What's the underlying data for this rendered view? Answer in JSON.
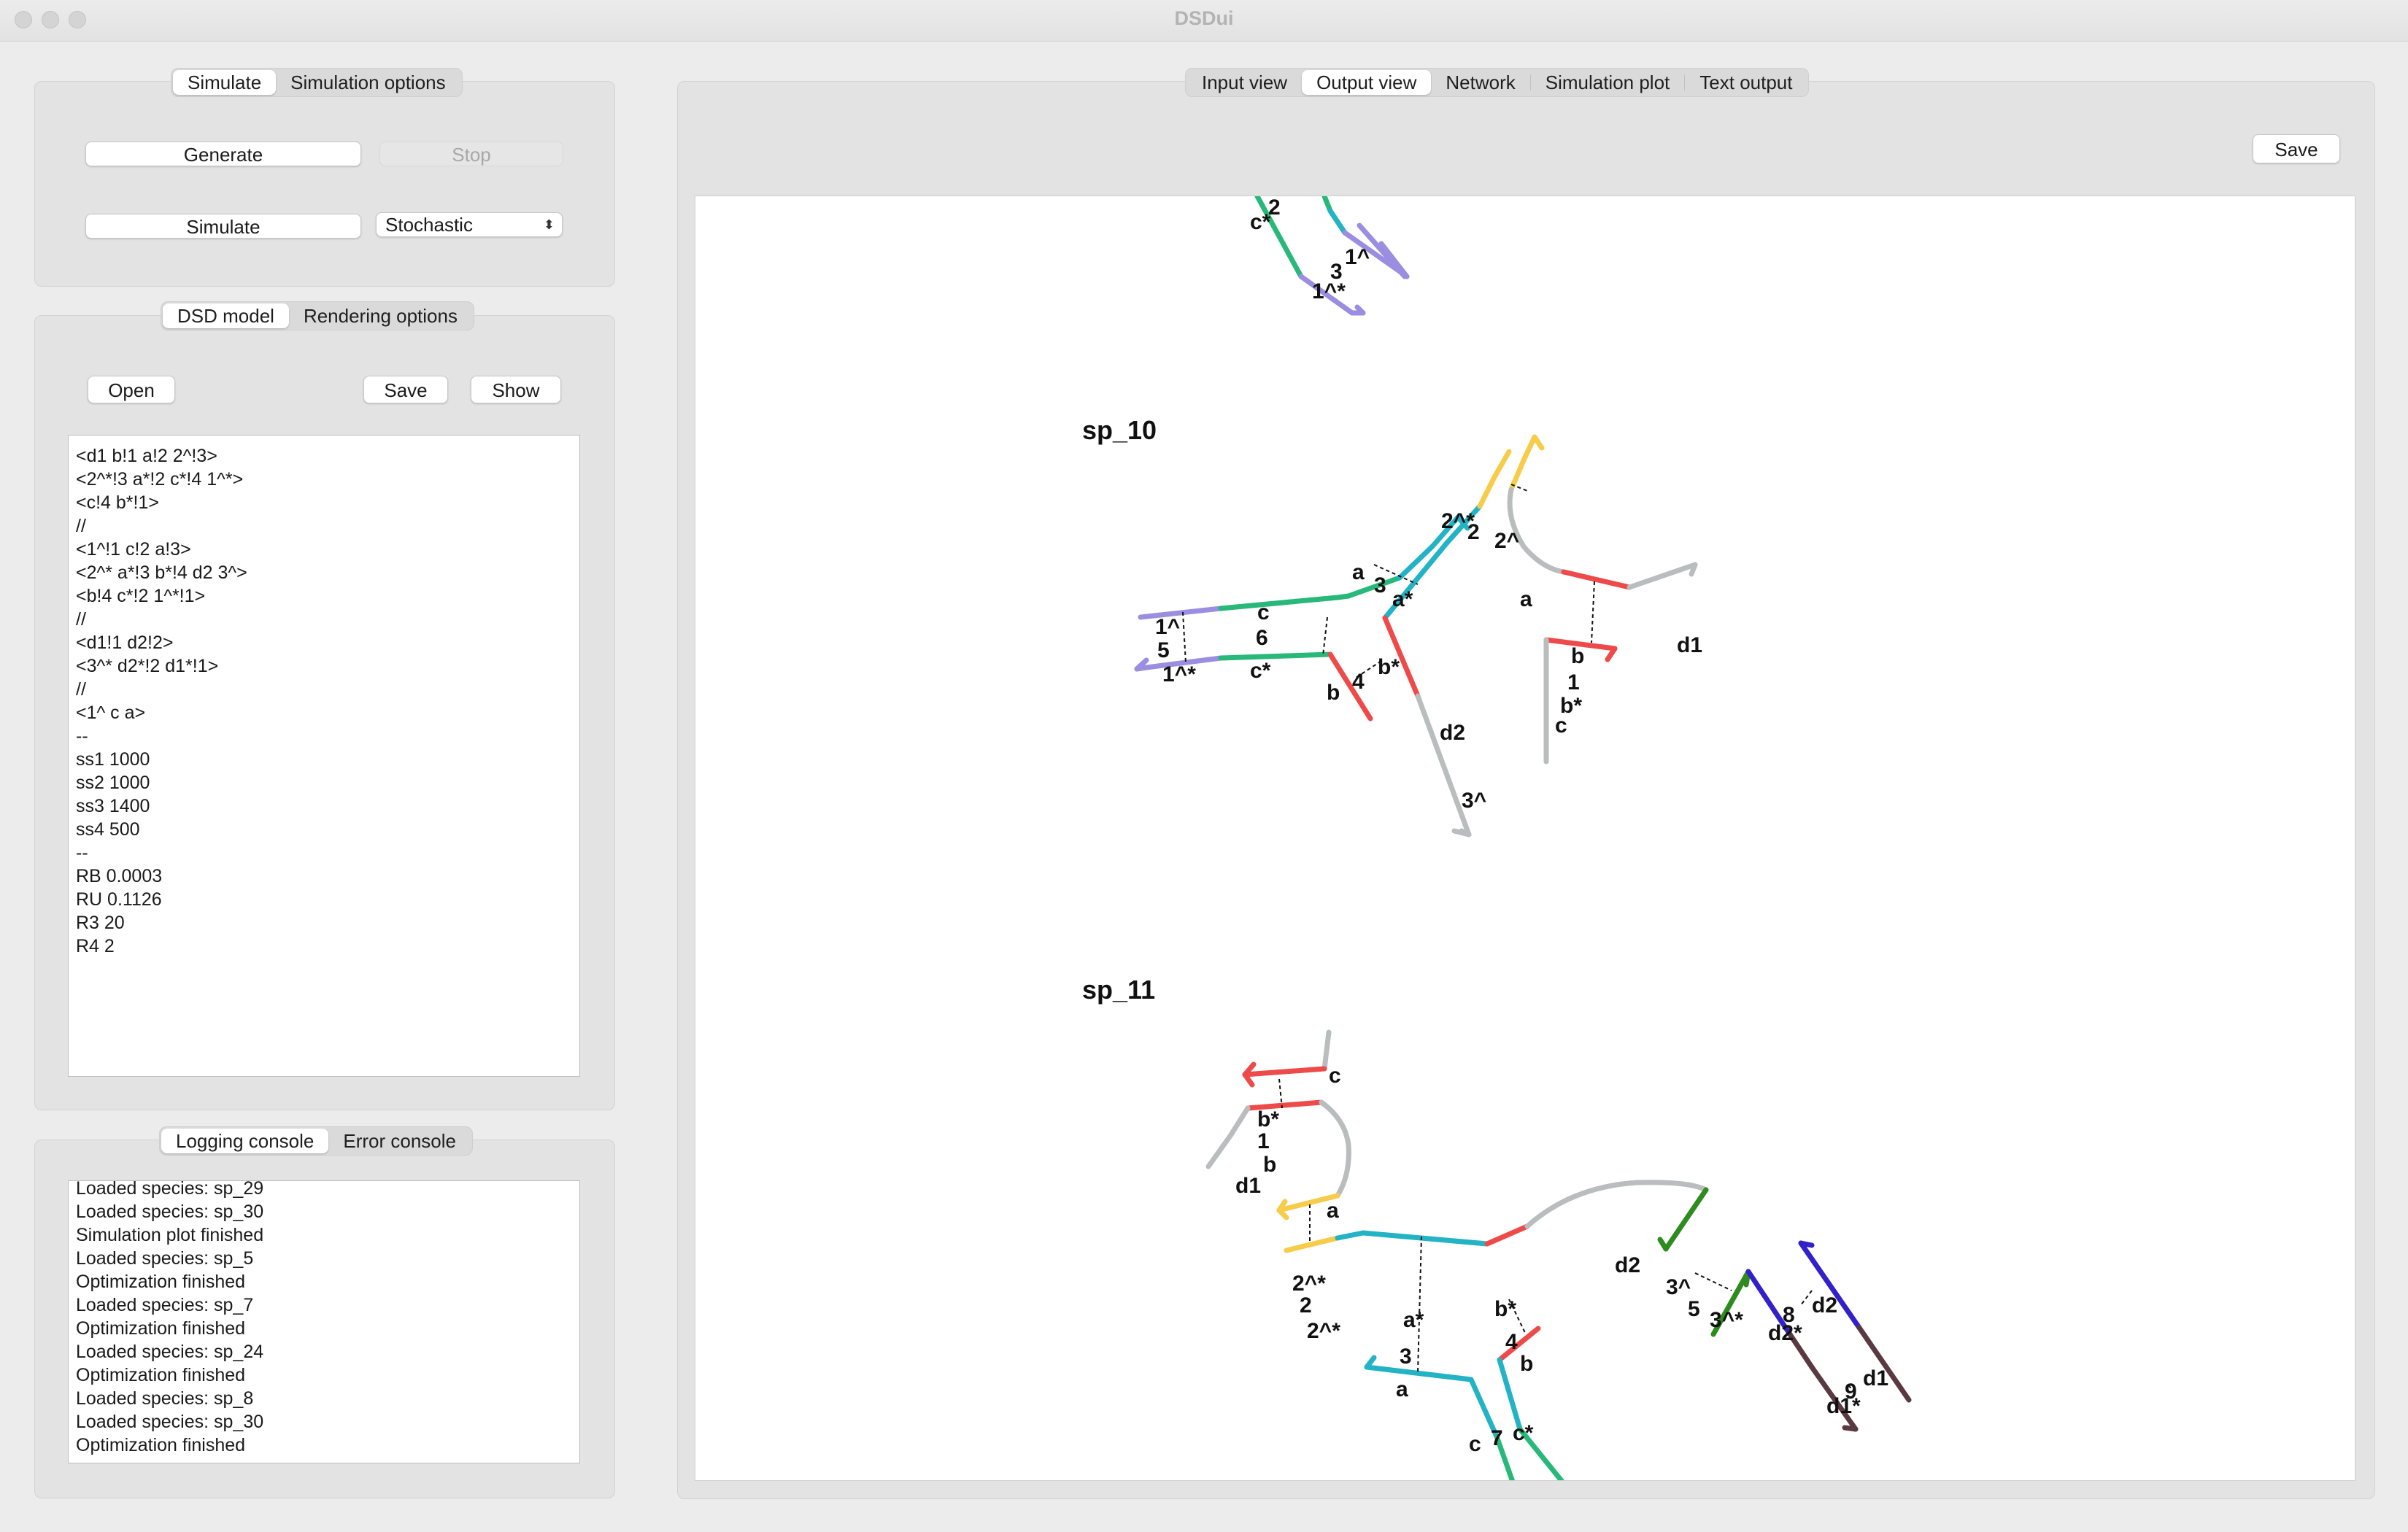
{
  "window": {
    "title": "DSDui"
  },
  "left": {
    "sim_tabs": [
      "Simulate",
      "Simulation options"
    ],
    "generate_label": "Generate",
    "stop_label": "Stop",
    "simulate_label": "Simulate",
    "mode_select": "Stochastic",
    "model_tabs": [
      "DSD model",
      "Rendering options"
    ],
    "open_label": "Open",
    "save_label": "Save",
    "show_label": "Show",
    "model_lines": [
      "<d1 b!1 a!2 2^!3>",
      "<2^*!3 a*!2 c*!4 1^*>",
      "<c!4 b*!1>",
      "//",
      "<1^!1 c!2 a!3>",
      "<2^* a*!3 b*!4 d2 3^>",
      "<b!4 c*!2 1^*!1>",
      "//",
      "<d1!1 d2!2>",
      "<3^* d2*!2 d1*!1>",
      "//",
      "<1^ c a>",
      "--",
      "ss1 1000",
      "ss2 1000",
      "ss3 1400",
      "ss4 500",
      "--",
      "RB 0.0003",
      "RU 0.1126",
      "R3 20",
      "R4 2"
    ],
    "console_tabs": [
      "Logging console",
      "Error console"
    ],
    "log_lines": [
      "Loaded species: sp_29",
      "Loaded species: sp_30",
      "Simulation plot finished",
      "Loaded species: sp_5",
      "Optimization finished",
      "Loaded species: sp_7",
      "Optimization finished",
      "Loaded species: sp_24",
      "Optimization finished",
      "Loaded species: sp_8",
      "Loaded species: sp_30",
      "Optimization finished"
    ]
  },
  "right": {
    "view_tabs": [
      "Input view",
      "Output view",
      "Network",
      "Simulation plot",
      "Text output"
    ],
    "active_view": "Output view",
    "save_label": "Save"
  },
  "species": {
    "sp_10": "sp_10",
    "sp_11": "sp_11"
  },
  "strand_colors": {
    "purple": "#9b8ee0",
    "green": "#27b87a",
    "teal": "#22b3c4",
    "red": "#ee4a4a",
    "yellow": "#f6cc4a",
    "gray": "#b9bdbd",
    "darkgreen": "#2e8b1e",
    "navy": "#3220c8",
    "brown": "#5a3a42"
  },
  "domain_labels": {
    "top": [
      "2",
      "c*",
      "3",
      "1^",
      "1^*"
    ],
    "sp10": [
      "a",
      "3",
      "a*",
      "c",
      "6",
      "c*",
      "1^",
      "5",
      "1^*",
      "b*",
      "4",
      "b",
      "d2",
      "3^",
      "2^*",
      "2",
      "2^",
      "a",
      "b",
      "1",
      "b*",
      "c",
      "d1"
    ],
    "sp11": [
      "c",
      "b*",
      "1",
      "b",
      "d1",
      "a",
      "2^*",
      "2",
      "2^*",
      "a*",
      "3",
      "a",
      "b*",
      "4",
      "b",
      "c",
      "7",
      "c*",
      "d2",
      "3^",
      "5",
      "3^*",
      "8",
      "d2",
      "d2*",
      "9",
      "d1",
      "d1*"
    ]
  }
}
